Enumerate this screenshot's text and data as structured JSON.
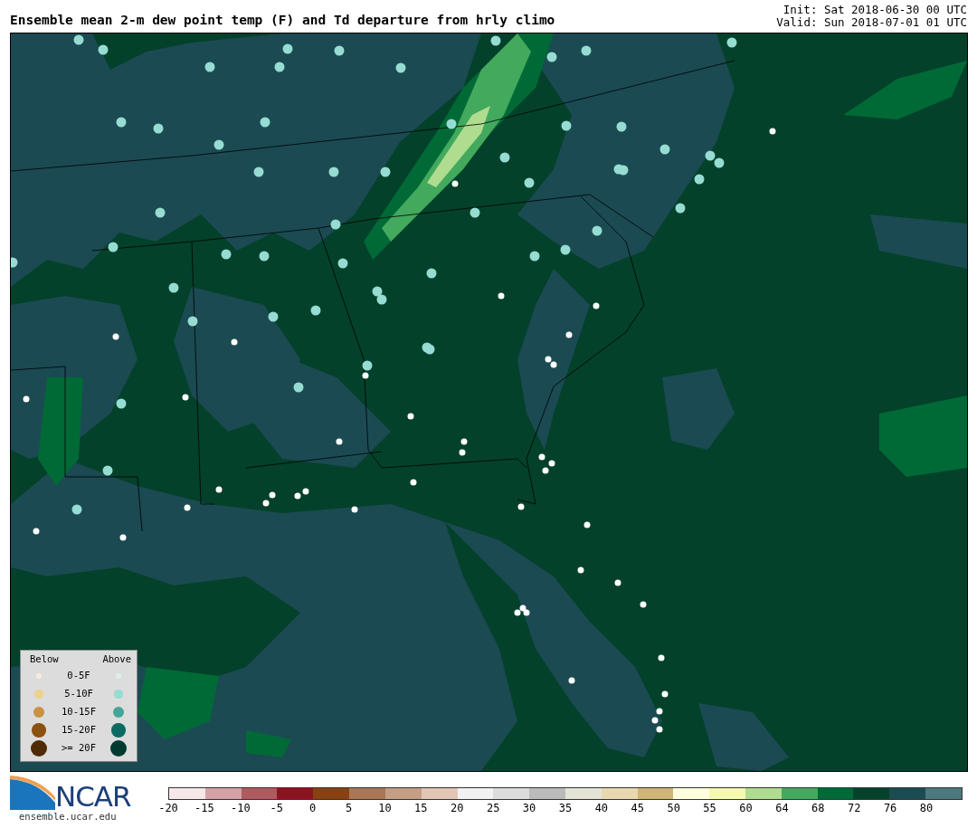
{
  "title": "Ensemble mean 2-m dew point temp (F) and Td departure from hrly climo",
  "init": "Init: Sat 2018-06-30 00 UTC",
  "valid": "Valid: Sun 2018-07-01 01 UTC",
  "legend": {
    "below_header": "Below",
    "above_header": "Above",
    "rows": [
      {
        "label": "0-5F",
        "below": {
          "color": "#f8ecd8"
        },
        "above": {
          "color": "#d9f0ee"
        }
      },
      {
        "label": "5-10F",
        "below": {
          "color": "#ecd28e"
        },
        "above": {
          "color": "#96dcd2"
        }
      },
      {
        "label": "10-15F",
        "below": {
          "color": "#c99140"
        },
        "above": {
          "color": "#45a598"
        }
      },
      {
        "label": "15-20F",
        "below": {
          "color": "#8c5010"
        },
        "above": {
          "color": "#0b6a62"
        }
      },
      {
        "label": ">= 20F",
        "below": {
          "color": "#4e2c06"
        },
        "above": {
          "color": "#003a30"
        }
      }
    ]
  },
  "logo": {
    "text": "NCAR",
    "url": "ensemble.ucar.edu"
  },
  "colorbar": {
    "segments": [
      {
        "color": "#f6e8e8",
        "label": "-20"
      },
      {
        "color": "#d5a1a5",
        "label": "-15"
      },
      {
        "color": "#af5a5e",
        "label": "-10"
      },
      {
        "color": "#8c1420",
        "label": "-5"
      },
      {
        "color": "#8a4112",
        "label": "0"
      },
      {
        "color": "#aa7653",
        "label": "5"
      },
      {
        "color": "#c59e84",
        "label": "10"
      },
      {
        "color": "#e1c6b6",
        "label": "15"
      },
      {
        "color": "#f2f2f2",
        "label": "20"
      },
      {
        "color": "#dcdcdc",
        "label": "25"
      },
      {
        "color": "#bababa",
        "label": "30"
      },
      {
        "color": "#e4e4d4",
        "label": "35"
      },
      {
        "color": "#e8d8b0",
        "label": "40"
      },
      {
        "color": "#ceb577",
        "label": "45"
      },
      {
        "color": "#ffffe0",
        "label": "50"
      },
      {
        "color": "#f5f9b0",
        "label": "55"
      },
      {
        "color": "#b0dc8f",
        "label": "60"
      },
      {
        "color": "#42a95d",
        "label": "64"
      },
      {
        "color": "#006a36",
        "label": "68"
      },
      {
        "color": "#04432b",
        "label": "72"
      },
      {
        "color": "#1b4c52",
        "label": "76"
      },
      {
        "color": "#4b797e",
        "label": "80"
      }
    ]
  }
}
